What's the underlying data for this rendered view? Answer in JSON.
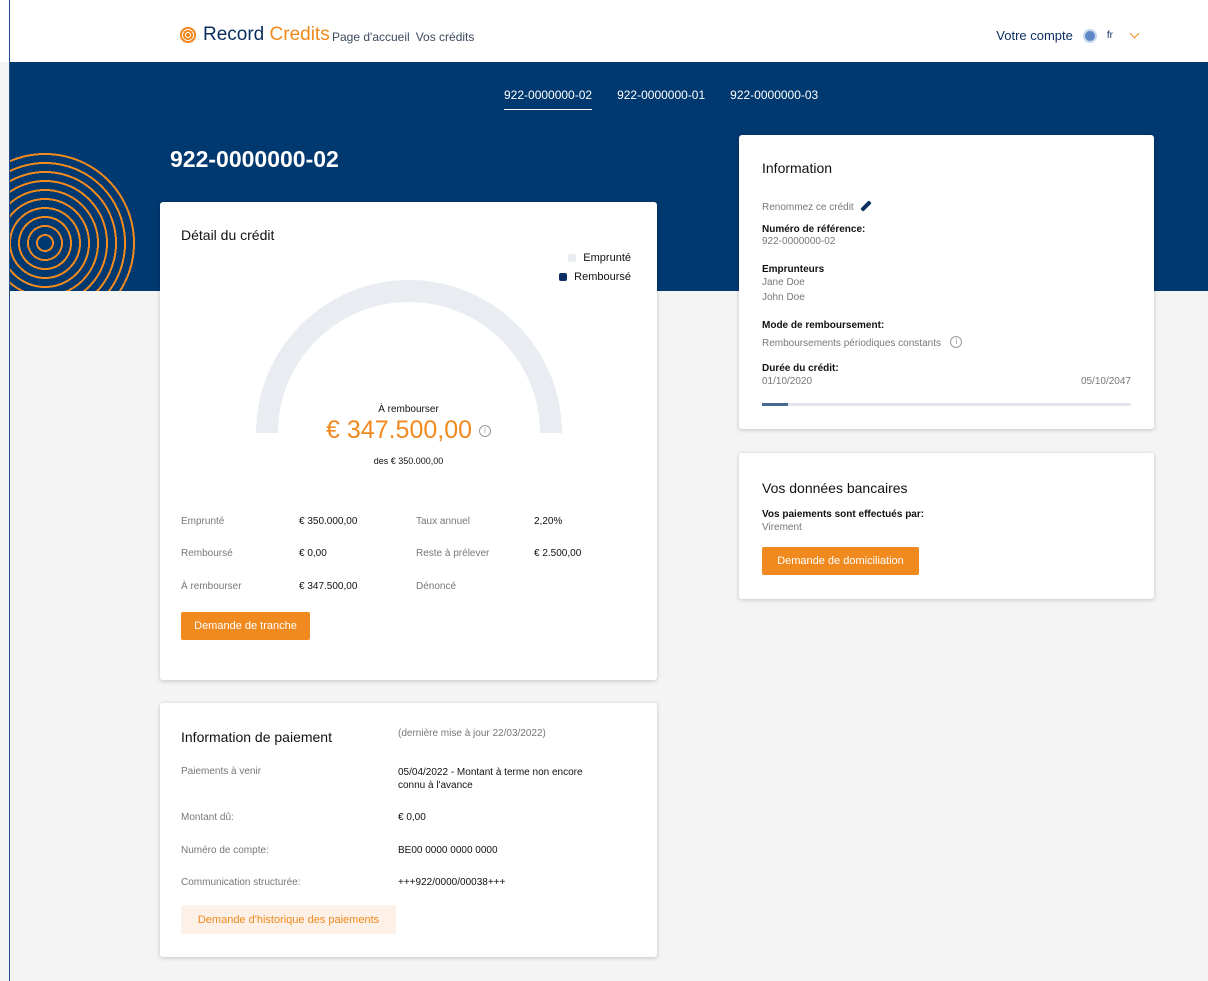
{
  "header": {
    "logo_record": "Record",
    "logo_credits": "Credits",
    "nav": [
      "Page d'accueil",
      "Vos crédits"
    ],
    "account_label": "Votre compte",
    "language": "fr"
  },
  "tabs": [
    "922-0000000-02",
    "922-0000000-01",
    "922-0000000-03"
  ],
  "active_tab": 0,
  "page_title": "922-0000000-02",
  "credit_detail": {
    "title": "Détail du crédit",
    "legend_borrowed": "Emprunté",
    "legend_repaid": "Remboursé",
    "gauge_repaid_fraction": 0,
    "to_repay_label": "À rembourser",
    "to_repay_amount": "€ 347.500,00",
    "of_total": "des € 350.000,00",
    "rows": {
      "borrowed_label": "Emprunté",
      "borrowed_value": "€ 350.000,00",
      "annual_rate_label": "Taux annuel",
      "annual_rate_value": "2,20%",
      "repaid_label": "Remboursé",
      "repaid_value": "€ 0,00",
      "remaining_label": "Reste à prélever",
      "remaining_value": "€ 2.500,00",
      "to_repay_label": "À rembourser",
      "to_repay_value": "€ 347.500,00",
      "denounced_label": "Dénoncé"
    },
    "tranche_button": "Demande de tranche"
  },
  "information": {
    "title": "Information",
    "rename": "Renommez ce crédit",
    "ref_label": "Numéro de référence:",
    "ref_value": "922-0000000-02",
    "borrowers_label": "Emprunteurs",
    "borrower_1": "Jane Doe",
    "borrower_2": "John Doe",
    "repayment_mode_label": "Mode de remboursement:",
    "repayment_mode_value": "Remboursements périodiques constants",
    "duration_label": "Durée du crédit:",
    "start_date": "01/10/2020",
    "end_date": "05/10/2047",
    "duration_progress_fraction": 0.07
  },
  "bank": {
    "title": "Vos données bancaires",
    "payments_by_label": "Vos paiements sont effectués par:",
    "payments_by_value": "Virement",
    "button": "Demande de domiciliation"
  },
  "payment_info": {
    "title": "Information de paiement",
    "last_update": "(dernière mise à jour 22/03/2022)",
    "upcoming_label": "Paiements à venir",
    "upcoming_value_line1": "05/04/2022 - Montant à terme non encore",
    "upcoming_value_line2": "connu à l'avance",
    "due_label": "Montant dû:",
    "due_value": "€ 0,00",
    "account_label": "Numéro de compte:",
    "account_value": "BE00 0000 0000 0000",
    "communication_label": "Communication structurée:",
    "communication_value": "+++922/0000/00038+++",
    "history_button": "Demande d'historique des paiements"
  },
  "colors": {
    "brand_orange": "#f08a1e",
    "brand_navy": "#003870",
    "gauge_track": "#e9edf2"
  }
}
